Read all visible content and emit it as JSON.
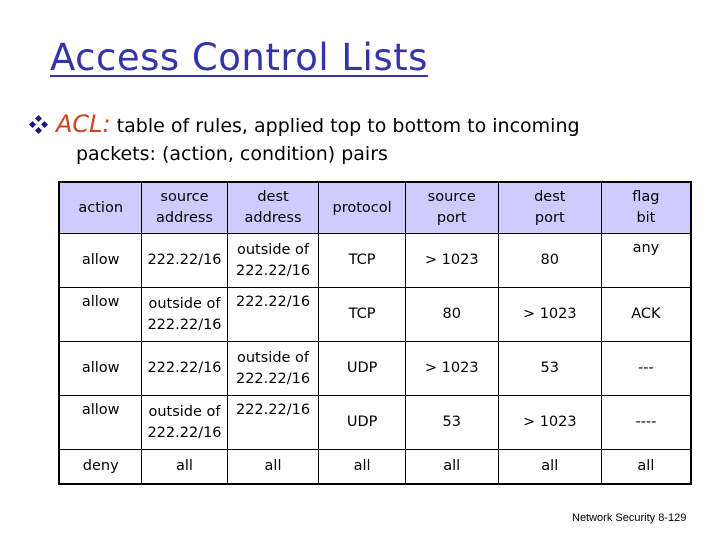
{
  "slide": {
    "title": "Access Control Lists",
    "bullet": {
      "icon": "diamond-cluster-bullet",
      "term": "ACL:",
      "text_line1": " table of rules, applied top to bottom to incoming",
      "text_line2": "packets: (action, condition) pairs"
    },
    "table": {
      "columns": [
        [
          "action",
          ""
        ],
        [
          "source",
          "address"
        ],
        [
          "dest",
          "address"
        ],
        [
          "protocol",
          ""
        ],
        [
          "source",
          "port"
        ],
        [
          "dest",
          "port"
        ],
        [
          "flag",
          "bit"
        ]
      ],
      "rows": [
        {
          "action": "allow",
          "src_addr": [
            "222.22/16",
            ""
          ],
          "dst_addr": [
            "outside of",
            "222.22/16"
          ],
          "protocol": "TCP",
          "src_port": "> 1023",
          "dst_port": "80",
          "flag": "any"
        },
        {
          "action": "allow",
          "src_addr": [
            "outside of",
            "222.22/16"
          ],
          "dst_addr": [
            "222.22/16",
            ""
          ],
          "protocol": "TCP",
          "src_port": "80",
          "dst_port": "> 1023",
          "flag": "ACK"
        },
        {
          "action": "allow",
          "src_addr": [
            "222.22/16",
            ""
          ],
          "dst_addr": [
            "outside of",
            "222.22/16"
          ],
          "protocol": "UDP",
          "src_port": "> 1023",
          "dst_port": "53",
          "flag": "---"
        },
        {
          "action": "allow",
          "src_addr": [
            "outside of",
            "222.22/16"
          ],
          "dst_addr": [
            "222.22/16",
            ""
          ],
          "protocol": "UDP",
          "src_port": "53",
          "dst_port": "> 1023",
          "flag": "----"
        },
        {
          "action": "deny",
          "src_addr": [
            "all",
            ""
          ],
          "dst_addr": [
            "all",
            ""
          ],
          "protocol": "all",
          "src_port": "all",
          "dst_port": "all",
          "flag": "all"
        }
      ]
    },
    "footer": "Network Security  8-129"
  },
  "colors": {
    "title": "#3333aa",
    "acl_term": "#cc4422",
    "header_fill": "#ccccff",
    "bullet": "#1a1a80"
  }
}
